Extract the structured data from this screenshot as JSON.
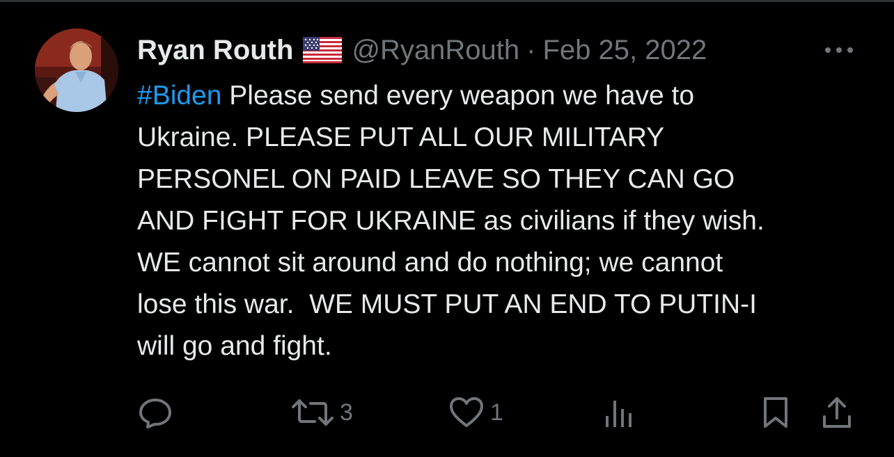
{
  "tweet": {
    "author": {
      "display_name": "Ryan Routh",
      "handle": "@RyanRouth",
      "flag_icon": "us-flag-icon",
      "avatar_icon": "avatar-photo"
    },
    "separator": "·",
    "date": "Feb 25, 2022",
    "more_icon": "more-horizontal-icon",
    "text": {
      "hashtag": "#Biden",
      "line1_rest": " Please send every weapon we have to",
      "line2": "Ukraine. PLEASE PUT ALL OUR MILITARY",
      "line3": "PERSONEL ON PAID LEAVE SO THEY CAN GO",
      "line4": "AND FIGHT FOR UKRAINE as civilians if they wish.",
      "line5": "WE cannot sit around and do nothing; we cannot",
      "line6": "lose this war.  WE MUST PUT AN END TO PUTIN-I",
      "line7": "will go and fight."
    },
    "actions": {
      "reply": {
        "icon": "reply-icon",
        "count": ""
      },
      "retweet": {
        "icon": "retweet-icon",
        "count": "3"
      },
      "like": {
        "icon": "heart-icon",
        "count": "1"
      },
      "views": {
        "icon": "views-chart-icon",
        "count": ""
      },
      "bookmark": {
        "icon": "bookmark-icon"
      },
      "share": {
        "icon": "share-icon"
      }
    }
  },
  "colors": {
    "background": "#000000",
    "text": "#e7e9ea",
    "secondary": "#71767b",
    "hashtag": "#1d9bf0",
    "divider": "#2f3336"
  }
}
